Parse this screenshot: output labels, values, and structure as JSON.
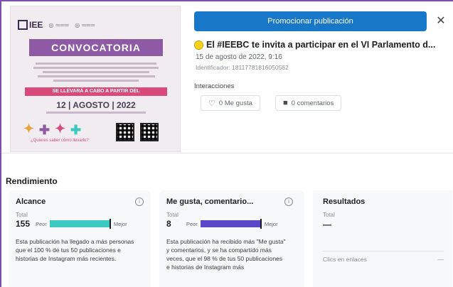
{
  "poster": {
    "logo": "IEE",
    "title": "CONVOCATORIA",
    "banner": "SE LLEVARÁ A CABO A PARTIR DEL",
    "date": "12 | AGOSTO | 2022",
    "art_caption": "¿Quieres saber cómo llevarlo?"
  },
  "panel": {
    "promote_label": "Promocionar publicación",
    "close_icon": "close-icon",
    "post_title": "El #IEEBC te invita a participar en el VI Parlamento d...",
    "post_date": "15 de agosto de 2022, 9:16",
    "post_id": "Identificador: 18117781816050562",
    "interactions_label": "Interacciones",
    "likes_chip": "0 Me gusta",
    "comments_chip": "0 comentarios"
  },
  "performance": {
    "title": "Rendimiento",
    "cards": [
      {
        "title": "Alcance",
        "total_label": "Total",
        "value": "155",
        "low_label": "Peor",
        "high_label": "Mejor",
        "fill_fraction": 0.98,
        "fill_color": "#3ec8c2",
        "description": "Esta publicación ha llegado a más personas que el 100 % de tus 50 publicaciones e historias de Instagram más recientes."
      },
      {
        "title": "Me gusta, comentario...",
        "total_label": "Total",
        "value": "8",
        "low_label": "Peor",
        "high_label": "Mejor",
        "fill_fraction": 0.98,
        "fill_color": "#5b47c9",
        "description": "Esta publicación ha recibido más \"Me gusta\" y comentarios, y se ha compartido más veces, que el 98 % de tus 50 publicaciones e historias de Instagram más"
      }
    ],
    "results": {
      "title": "Resultados",
      "total_label": "Total",
      "value": "—",
      "link_clicks_label": "Clics en enlaces",
      "link_clicks_value": "—"
    }
  }
}
